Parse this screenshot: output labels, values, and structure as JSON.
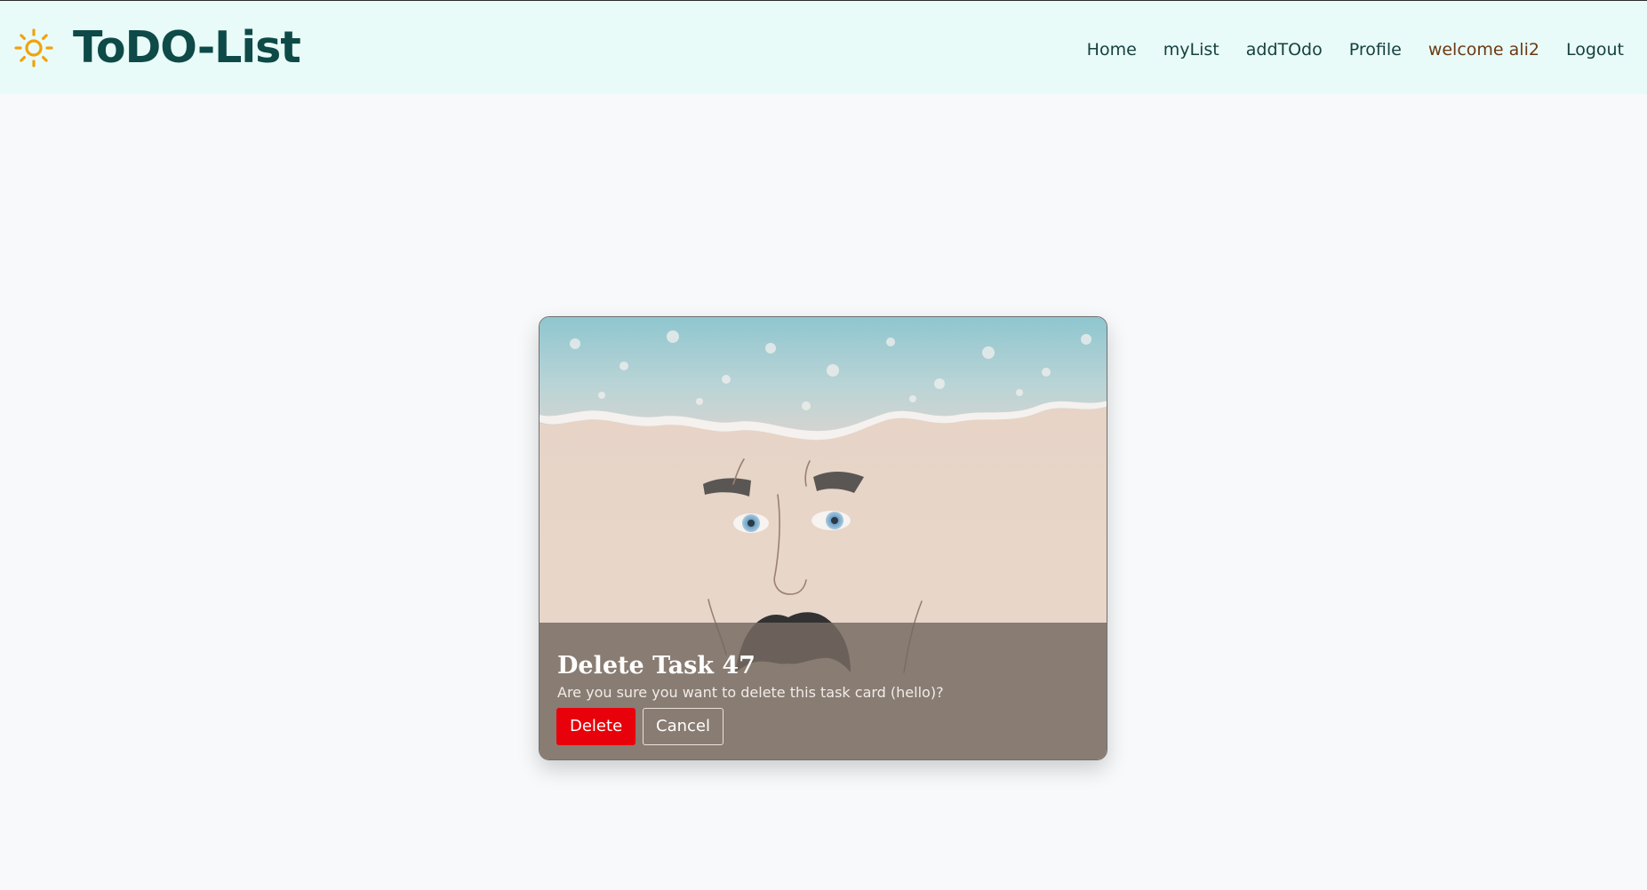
{
  "navbar": {
    "brand": "ToDO-List",
    "brand_icon": "sun-icon",
    "links": [
      {
        "label": "Home"
      },
      {
        "label": "myList"
      },
      {
        "label": "addTOdo"
      },
      {
        "label": "Profile"
      },
      {
        "label": "welcome ali2"
      },
      {
        "label": "Logout"
      }
    ]
  },
  "card": {
    "image": "beach-sand-face-image",
    "title": "Delete Task 47",
    "text": "Are you sure you want to delete this task card (hello)?",
    "delete_label": "Delete",
    "cancel_label": "Cancel"
  },
  "colors": {
    "navbar_bg": "#e8fbf9",
    "brand": "#0e4a47",
    "welcome": "#6b3a14",
    "delete_button": "#e8000b",
    "page_bg": "#f7f9fb"
  }
}
